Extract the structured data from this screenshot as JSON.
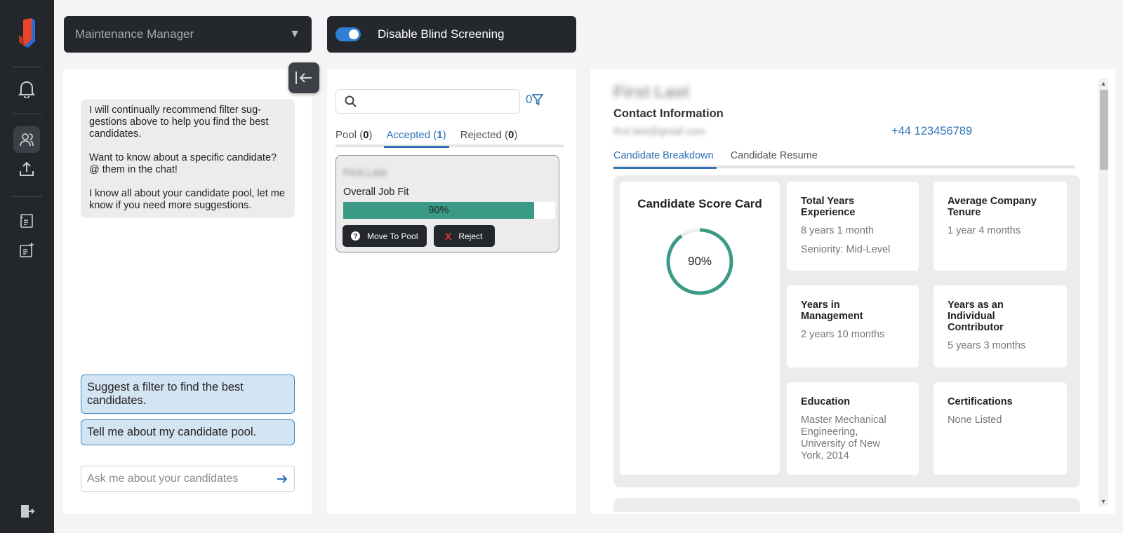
{
  "top": {
    "job_select": "Maintenance Manager",
    "blind_label": "Disable Blind Screening"
  },
  "chat": {
    "messages": [
      "I will continually recommend filter sug­gestions above to help you find the best candidates.",
      "Want to know about a specific candi­date? @ them in the chat!",
      "I know all about your candidate pool, let me know if you need more suggestions."
    ],
    "suggestions": [
      "Suggest a filter to find the best candidates.",
      "Tell me about my candidate pool."
    ],
    "input_placeholder": "Ask me about your candidates"
  },
  "list": {
    "filter_count": "0",
    "tabs": [
      {
        "label": "Pool",
        "count": "0"
      },
      {
        "label": "Accepted",
        "count": "1"
      },
      {
        "label": "Rejected",
        "count": "0"
      }
    ],
    "card": {
      "name": "First Last",
      "fit_label": "Overall Job Fit",
      "fit_value": 90,
      "fit_text": "90%",
      "move_label": "Move To Pool",
      "reject_label": "Reject"
    }
  },
  "detail": {
    "name": "First Last",
    "contact_title": "Contact Information",
    "email": "first.last@gmail.com",
    "phone": "+44 123456789",
    "tabs": [
      "Candidate Breakdown",
      "Candidate Resume"
    ],
    "score_title": "Candidate Score Card",
    "score_value": 90,
    "score_text": "90%",
    "cells": [
      {
        "title": "Total Years Experience",
        "values": [
          "8 years 1 month",
          "Seniority: Mid-Level"
        ]
      },
      {
        "title": "Average Company Tenure",
        "values": [
          "1 year 4 months"
        ]
      },
      {
        "title": "Years in Management",
        "values": [
          "2 years 10 months"
        ]
      },
      {
        "title": "Years as an Individual Contributor",
        "values": [
          "5 years 3 months"
        ]
      },
      {
        "title": "Education",
        "values": [
          "Master Mechanical Engineering, University of New York, 2014"
        ]
      },
      {
        "title": "Certifications",
        "values": [
          "None Listed"
        ]
      }
    ]
  },
  "colors": {
    "accent": "#2f72b8",
    "fit_bar": "#3a9a86",
    "sidebar": "#23262b"
  }
}
